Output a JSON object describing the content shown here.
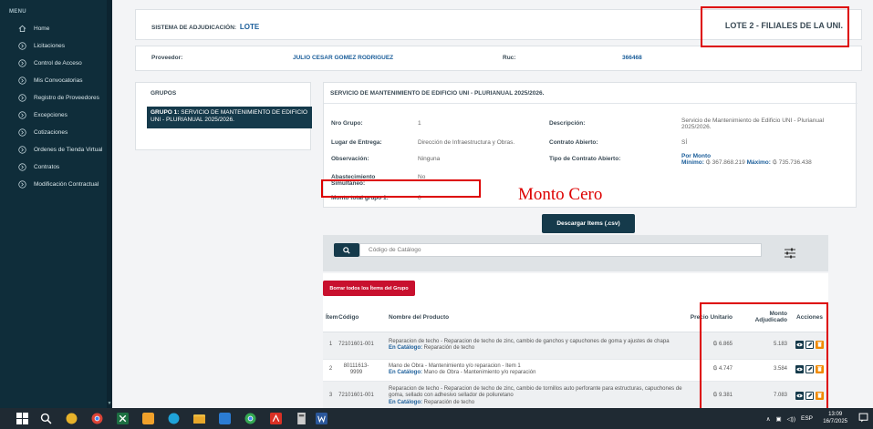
{
  "sidebar": {
    "title": "MENU",
    "items": [
      {
        "label": "Home",
        "icon": "home-icon"
      },
      {
        "label": "Licitaciones",
        "icon": "chevron-circle-icon"
      },
      {
        "label": "Control de Acceso",
        "icon": "chevron-circle-icon"
      },
      {
        "label": "Mis Convocatorias",
        "icon": "chevron-circle-icon"
      },
      {
        "label": "Registro de Proveedores",
        "icon": "chevron-circle-icon"
      },
      {
        "label": "Excepciones",
        "icon": "chevron-circle-icon"
      },
      {
        "label": "Cotizaciones",
        "icon": "chevron-circle-icon"
      },
      {
        "label": "Ordenes de Tienda Virtual",
        "icon": "chevron-circle-icon"
      },
      {
        "label": "Contratos",
        "icon": "chevron-circle-icon"
      },
      {
        "label": "Modificación Contractual",
        "icon": "chevron-circle-icon"
      }
    ]
  },
  "header": {
    "sistema_label": "SISTEMA DE ADJUDICACIÓN:",
    "sistema_value": "LOTE",
    "lote": "LOTE 2 - FILIALES DE LA UNI."
  },
  "proveedor": {
    "label": "Proveedor:",
    "value": "JULIO CESAR GOMEZ RODRIGUEZ",
    "ruc_label": "Ruc:",
    "ruc_value": "366468"
  },
  "grupos": {
    "title": "GRUPOS",
    "selected_prefix": "GRUPO 1:",
    "selected_text": "SERVICIO DE MANTENIMIENTO DE EDIFICIO UNI - PLURIANUAL 2025/2026."
  },
  "detail": {
    "title": "SERVICIO DE MANTENIMIENTO DE EDIFICIO UNI - PLURIANUAL 2025/2026.",
    "nro_grupo_label": "Nro Grupo:",
    "nro_grupo_value": "1",
    "lugar_label": "Lugar de Entrega:",
    "lugar_value": "Dirección de Infraestructura y Obras.",
    "observacion_label": "Observación:",
    "observacion_value": "Ninguna",
    "abastecimiento_label": "Abastecimiento Simultáneo:",
    "abastecimiento_value": "No",
    "monto_label": "Monto total grupo 1:",
    "monto_value": "0",
    "descripcion_label": "Descripción:",
    "descripcion_value": "Servicio de Mantenimiento de Edificio UNI - Plurianual 2025/2026.",
    "contrato_label": "Contrato Abierto:",
    "contrato_value": "SÍ",
    "tipo_label": "Tipo de Contrato Abierto:",
    "tipo_value": "Por Monto",
    "minimo_label": "Mínimo:",
    "minimo_value": "₲ 367.868.219",
    "maximo_label": "Máximo:",
    "maximo_value": "₲ 735.736.438"
  },
  "annotation": "Monto Cero",
  "download_button": "Descargar Items (.csv)",
  "search": {
    "placeholder": "Código de Catálogo"
  },
  "delete_all_button": "Borrar todos los Ítems del Grupo",
  "table": {
    "headers": {
      "item": "Ítem",
      "codigo": "Código",
      "nombre": "Nombre del Producto",
      "precio": "Precio Unitario",
      "monto": "Monto Adjudicado",
      "acciones": "Acciones"
    },
    "rows": [
      {
        "item": "1",
        "codigo": "72101601-001",
        "nombre": "Reparacion de techo - Reparacion de techo de zinc, cambio de ganchos y capuchones de goma y ajustes de chapa",
        "catalogo_label": "En Catálogo:",
        "catalogo": "Reparación de techo",
        "precio": "₲ 6.865",
        "monto": "5.183"
      },
      {
        "item": "2",
        "codigo": "80111613-9999",
        "nombre": "Mano de Obra - Mantenimiento y/o reparacion - Item 1",
        "catalogo_label": "En Catálogo:",
        "catalogo": "Mano de Obra - Mantenimiento y/o reparación",
        "precio": "₲ 4.747",
        "monto": "3.584"
      },
      {
        "item": "3",
        "codigo": "72101601-001",
        "nombre": "Reparacion de techo - Reparacion de techo de zinc, cambio de tornillos auto perforante para estructuras, capuchones de goma, sellado con adhesivo sellador de poliuretano",
        "catalogo_label": "En Catálogo:",
        "catalogo": "Reparación de techo",
        "precio": "₲ 9.381",
        "monto": "7.083"
      }
    ]
  },
  "taskbar": {
    "lang": "ESP",
    "time": "13:09",
    "date": "16/7/2025"
  }
}
